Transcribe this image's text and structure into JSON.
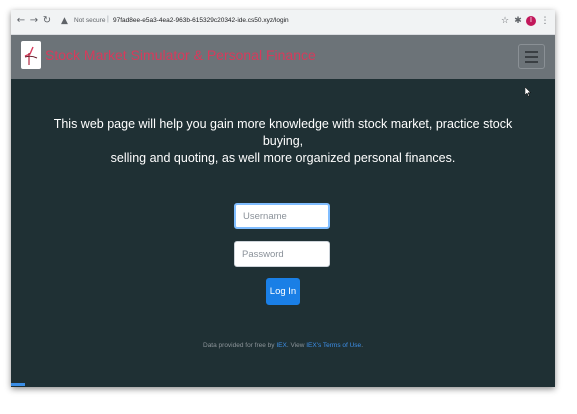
{
  "browser": {
    "security_label": "Not secure",
    "url": "97fad8ee-e5a3-4ea2-963b-615329c20342-ide.cs50.xyz/login",
    "profile_initial": "I",
    "icons": [
      "back-arrow-icon",
      "forward-arrow-icon",
      "reload-icon",
      "warning-icon",
      "star-icon",
      "extensions-icon",
      "more-vert-icon"
    ]
  },
  "navbar": {
    "brand": "Stock Market Simulator & Personal Finance",
    "brand_color": "#d63b5c",
    "background": "#6c7378"
  },
  "main": {
    "lead_line1": "This web page will help you gain more knowledge with stock market, practice stock buying,",
    "lead_line2": "selling and quoting, as well more organized personal finances.",
    "background": "#1f3034"
  },
  "form": {
    "username_placeholder": "Username",
    "password_placeholder": "Password",
    "login_label": "Log In",
    "button_color": "#1a7fe6"
  },
  "footer": {
    "prefix": "Data provided for free by ",
    "iex_link": "IEX",
    "middle": ". View ",
    "terms_link": "IEX's Terms of Use",
    "suffix": "."
  }
}
